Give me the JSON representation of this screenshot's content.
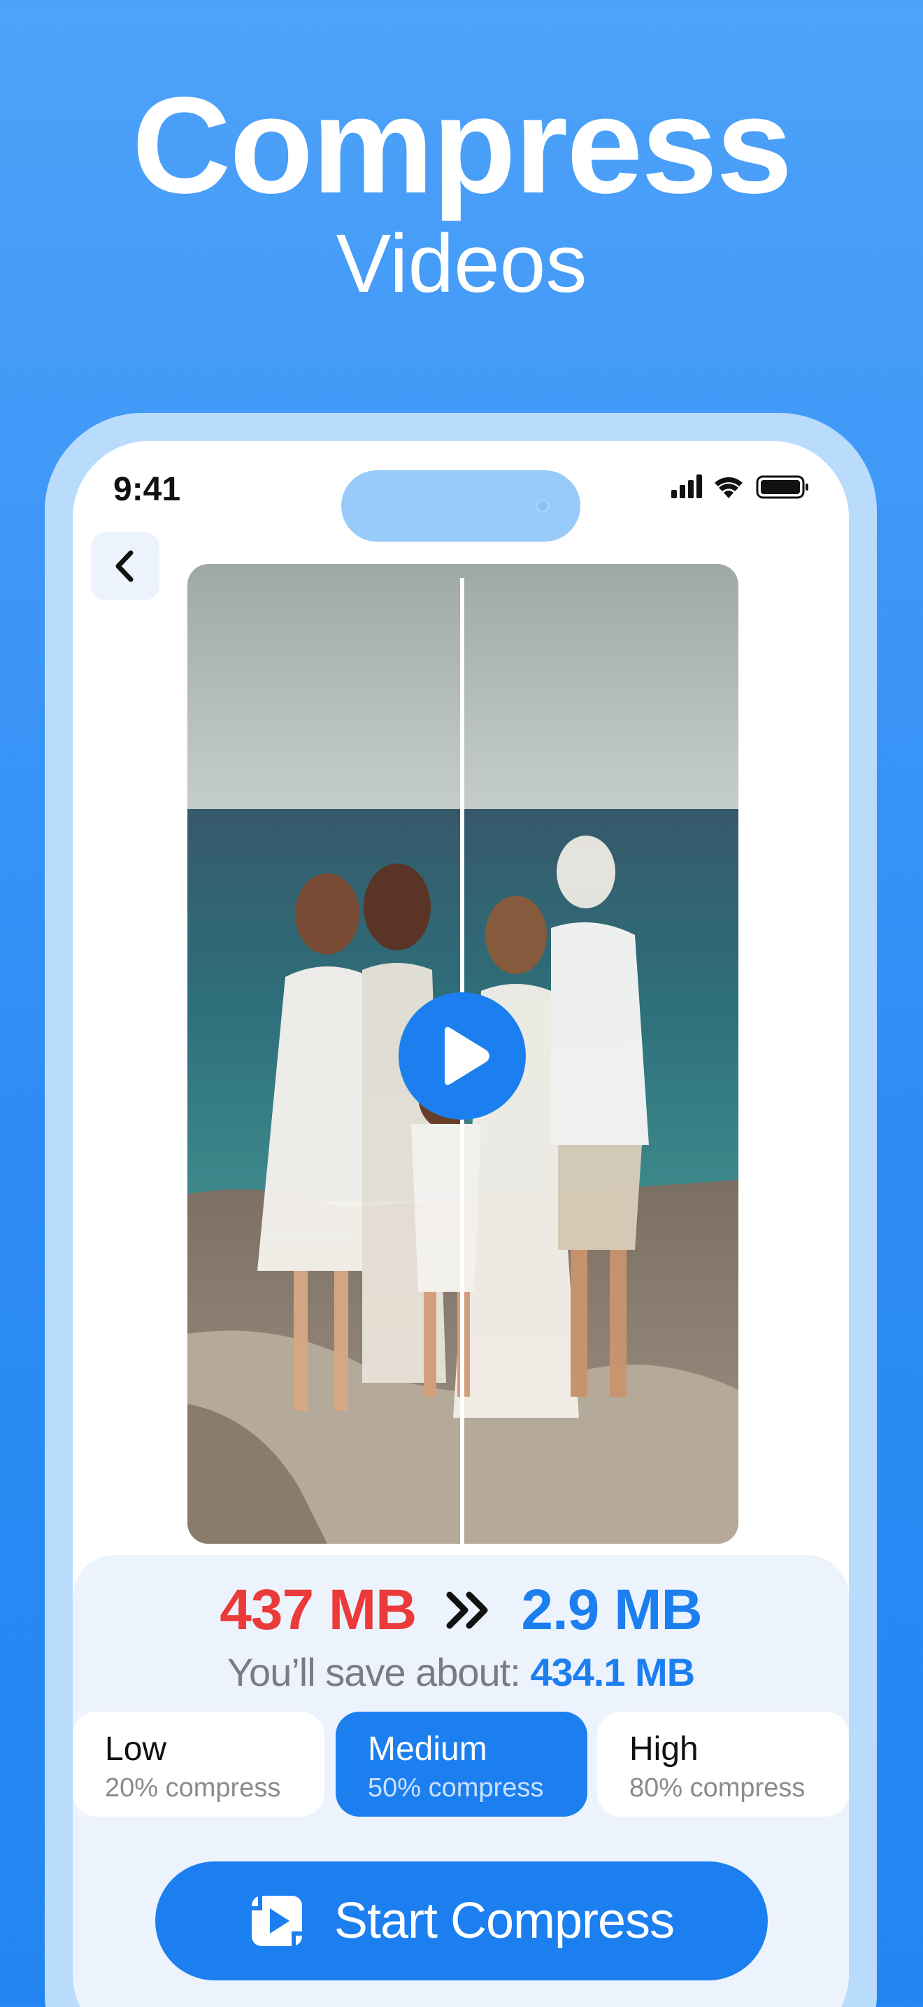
{
  "hero": {
    "title": "Compress",
    "subtitle": "Videos"
  },
  "status_bar": {
    "time": "9:41",
    "icons": [
      "signal-icon",
      "wifi-icon",
      "battery-icon"
    ]
  },
  "nav": {
    "back_icon": "chevron-left-icon"
  },
  "preview": {
    "play_icon": "play-icon",
    "comparison_split": 0.5
  },
  "summary": {
    "size_before": "437 MB",
    "separator_icon": "double-chevron-right-icon",
    "size_after": "2.9 MB",
    "save_prefix": "You’ll save about:",
    "save_value": "434.1 MB"
  },
  "compression_options": [
    {
      "name": "Low",
      "desc": "20% compress",
      "selected": false
    },
    {
      "name": "Medium",
      "desc": "50% compress",
      "selected": true
    },
    {
      "name": "High",
      "desc": "80% compress",
      "selected": false
    }
  ],
  "action": {
    "start_label": "Start Compress",
    "start_icon": "compress-video-icon"
  },
  "colors": {
    "background": "#2e8df5",
    "accent": "#1c7ff0",
    "before_size": "#ea3a3a",
    "panel": "#edf3fd"
  }
}
